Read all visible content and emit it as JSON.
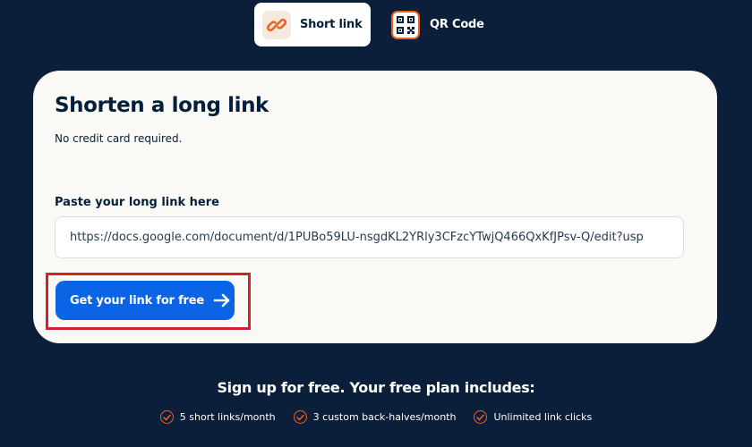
{
  "tabs": [
    {
      "label": "Short link",
      "icon": "link-icon",
      "active": true
    },
    {
      "label": "QR Code",
      "icon": "qr-code-icon",
      "active": false
    }
  ],
  "card": {
    "title": "Shorten a long link",
    "subtitle": "No credit card required.",
    "field_label": "Paste your long link here",
    "url_value": "https://docs.google.com/document/d/1PUBo59LU-nsgdKL2YRly3CFzcYTwjQ466QxKfJPsv-Q/edit?usp",
    "cta_label": "Get your link for free",
    "cta_icon": "arrow-right-icon"
  },
  "plan": {
    "heading": "Sign up for free. Your free plan includes:",
    "features": [
      "5 short links/month",
      "3 custom back-halves/month",
      "Unlimited link clicks"
    ],
    "feature_icon": "check-circle-icon"
  },
  "colors": {
    "background": "#0c1f3a",
    "card": "#fbf9f5",
    "primary": "#0b63e5",
    "accent": "#ee6123",
    "highlight": "#d2212a"
  }
}
